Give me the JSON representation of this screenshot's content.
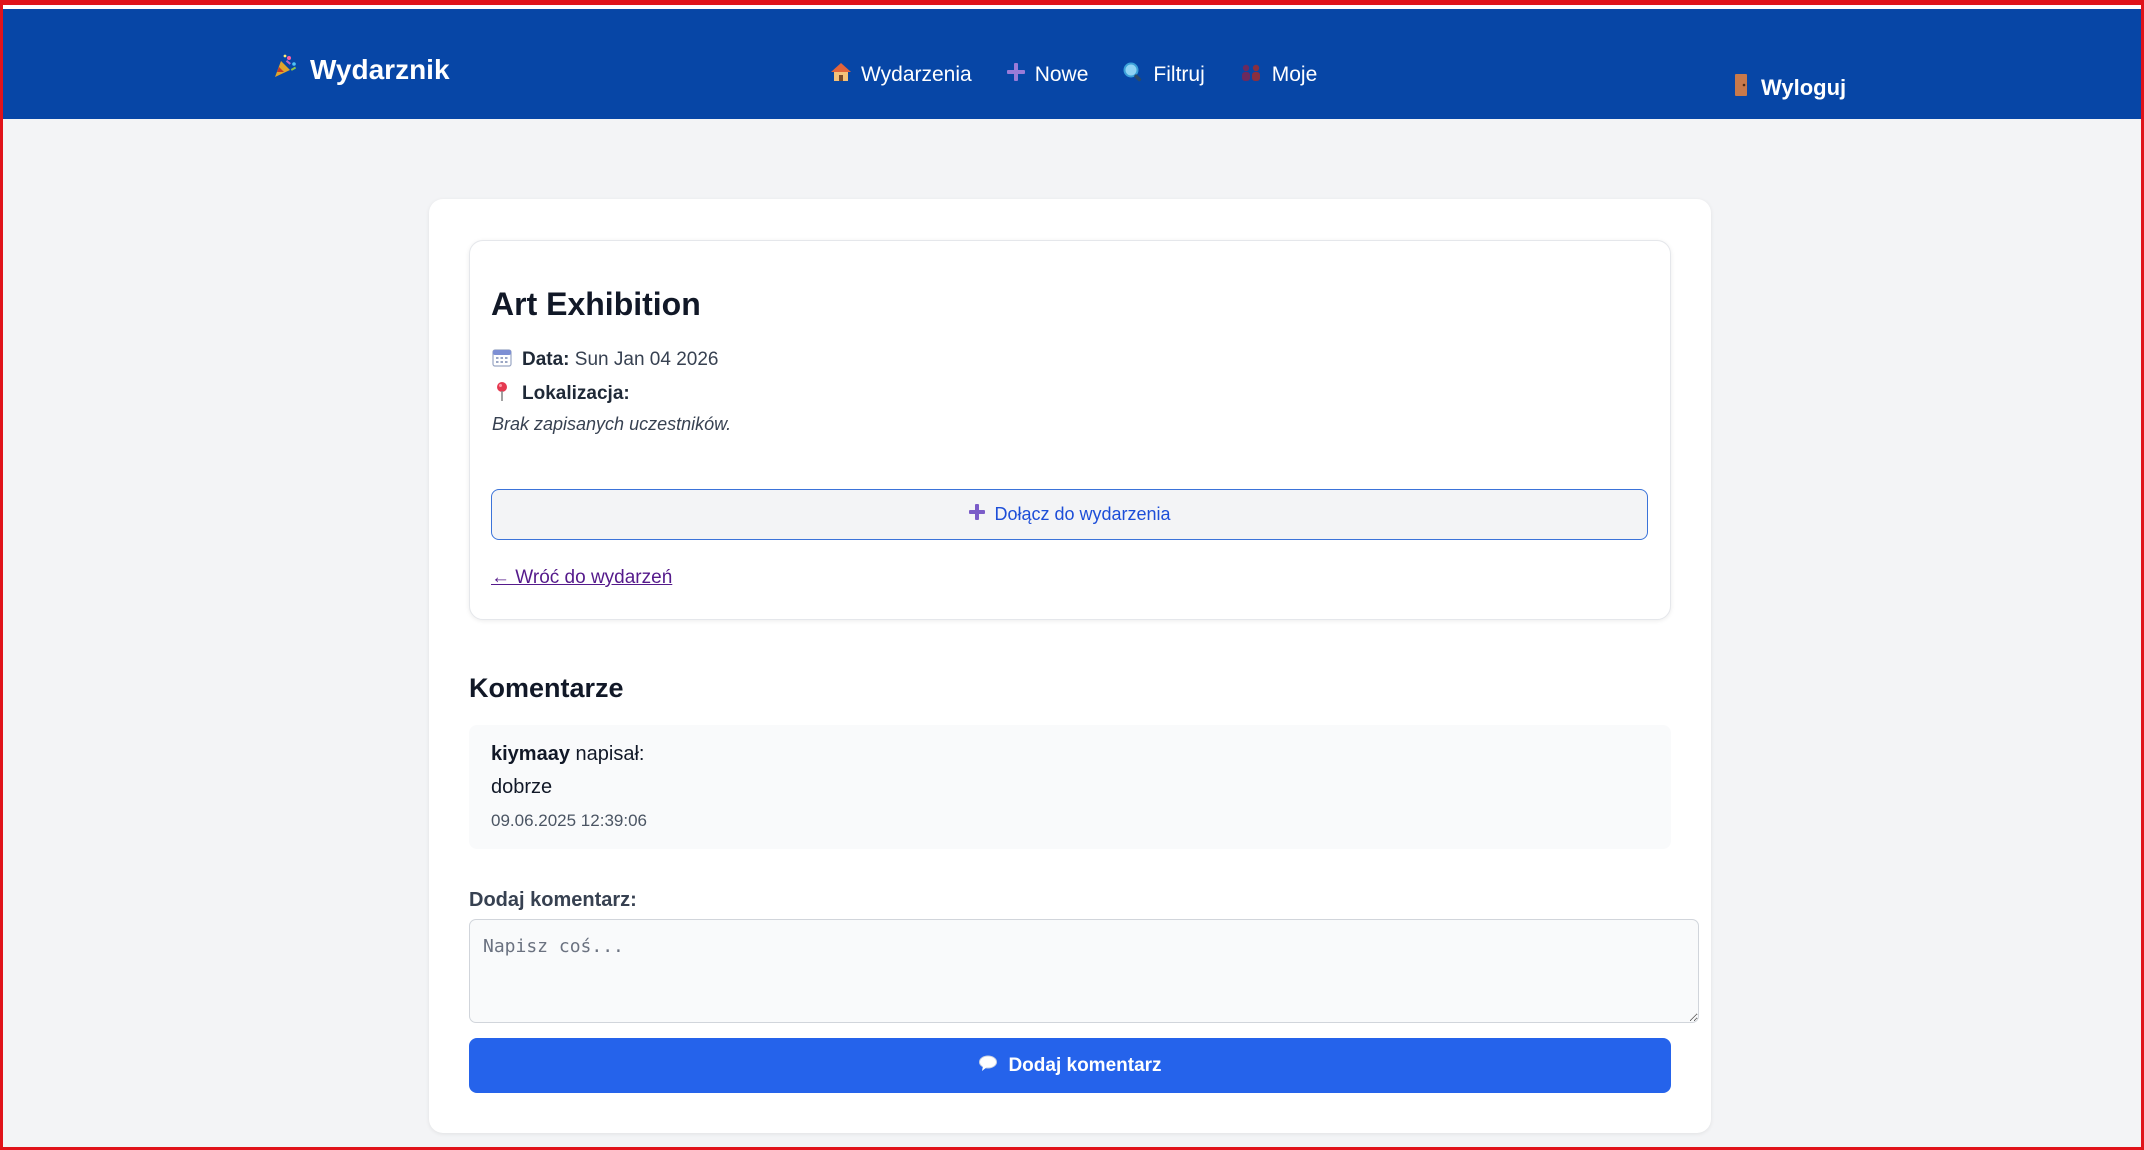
{
  "nav": {
    "brand": "Wydarznik",
    "links": [
      {
        "label": "Wydarzenia",
        "icon": "house-icon"
      },
      {
        "label": "Nowe",
        "icon": "plus-icon"
      },
      {
        "label": "Filtruj",
        "icon": "magnifier-icon"
      },
      {
        "label": "Moje",
        "icon": "people-icon"
      }
    ],
    "logout": "Wyloguj"
  },
  "event": {
    "title": "Art Exhibition",
    "date_label": "Data:",
    "date_value": "Sun Jan 04 2026",
    "location_label": "Lokalizacja:",
    "location_value": "",
    "no_participants": "Brak zapisanych uczestników.",
    "join_button": "Dołącz do wydarzenia",
    "back_link": "← Wróć do wydarzeń"
  },
  "comments": {
    "heading": "Komentarze",
    "items": [
      {
        "author": "kiymaay",
        "wrote": "napisał:",
        "text": "dobrze",
        "date": "09.06.2025 12:39:06"
      }
    ],
    "add_label": "Dodaj komentarz:",
    "placeholder": "Napisz coś...",
    "input_value": "",
    "submit": "Dodaj komentarz"
  },
  "colors": {
    "navbar": "#0746a6",
    "accent": "#2563eb",
    "frame": "#e0131a",
    "page_bg": "#f3f4f6"
  }
}
